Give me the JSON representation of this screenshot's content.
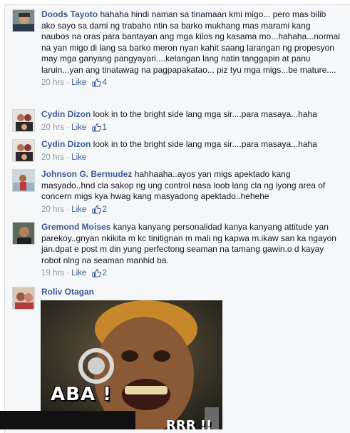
{
  "comments": [
    {
      "author": "Doods Tayoto",
      "text": "hahaha hindi naman sa tinamaan kmi migo... pero mas bilib ako sayo sa dami ng trabaho ntin sa barko mukhang mas marami kang naubos na oras para bantayan ang mga kilos ng kasama mo...hahaha...normal na yan migo di lang sa barko meron nyan kahit saang larangan ng propesyon may mga ganyang pangyayari....kelangan lang natin tanggapin at panu laruin...yan ang tinatawag na pagpapakatao... piz tyu mga migs...be mature....",
      "time": "20 hrs",
      "sep": " · ",
      "like": "Like",
      "likes": "4"
    },
    {
      "author": "Cydin Dizon",
      "text": "look in to the bright side lang mga sir....para masaya...haha",
      "time": "20 hrs",
      "sep": " · ",
      "like": "Like",
      "likes": "1"
    },
    {
      "author": "Cydin Dizon",
      "text": "look in to the bright side lang mga sir....para masaya...haha",
      "time": "20 hrs",
      "sep": " · ",
      "like": "Like",
      "likes": ""
    },
    {
      "author": "Johnson G. Bermudez",
      "text": "hahhaaha..ayos yan migs apektado kang masyado..hnd cla sakop ng ung control nasa loob lang cla ng iyong area of concern migs kya hwag kang masyadong apektado..hehehe",
      "time": "20 hrs",
      "sep": " · ",
      "like": "Like",
      "likes": "2"
    },
    {
      "author": "Gremond Moises",
      "text": "kanya kanyang personalidad kanya kanyang attitude yan parekoy..gnyan nkikita m kc tinitignan m mali ng kapwa m.ikaw san ka ngayon jan.dpat e post m din yung perfectong seaman na tamang gawin.o d kayay robot nlng na seaman manhid ba.",
      "time": "19 hrs",
      "sep": " · ",
      "like": "Like",
      "likes": "2"
    },
    {
      "author": "Roliv Otagan",
      "text": "",
      "time": "",
      "sep": "",
      "like": "",
      "likes": ""
    }
  ],
  "photo": {
    "caption": "ABA !",
    "caption2": "RRR !!"
  },
  "colors": {
    "link": "#3b5998",
    "meta": "#9197a3",
    "background": "#f6f7f9"
  },
  "icons": {
    "like_icon": "thumbs-up"
  }
}
